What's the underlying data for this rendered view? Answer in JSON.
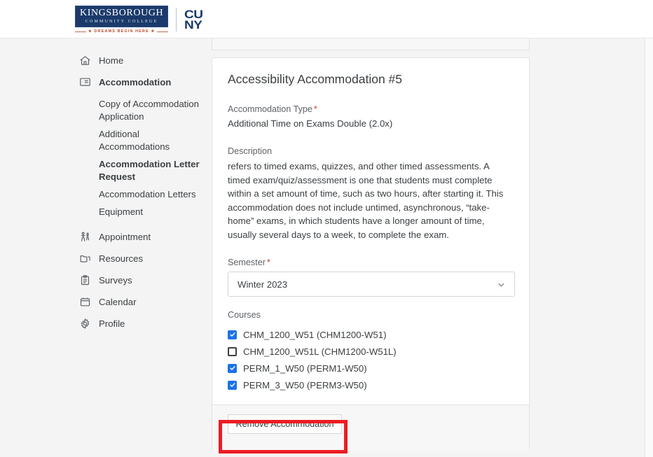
{
  "header": {
    "kbcc_name": "KINGSBOROUGH",
    "kbcc_sub": "COMMUNITY COLLEGE",
    "kbcc_tagline": "★ DREAMS BEGIN HERE ★",
    "cuny_line1": "CU",
    "cuny_line2": "NY"
  },
  "sidebar": {
    "items": [
      {
        "label": "Home",
        "icon": "home-icon"
      },
      {
        "label": "Accommodation",
        "icon": "accommodation-icon"
      },
      {
        "label": "Appointment",
        "icon": "appointment-icon"
      },
      {
        "label": "Resources",
        "icon": "folder-icon"
      },
      {
        "label": "Surveys",
        "icon": "clipboard-icon"
      },
      {
        "label": "Calendar",
        "icon": "calendar-icon"
      },
      {
        "label": "Profile",
        "icon": "gear-icon"
      }
    ],
    "sub_items": [
      {
        "label": "Copy of Accommodation Application",
        "active": false
      },
      {
        "label": "Additional Accommodations",
        "active": false
      },
      {
        "label": "Accommodation Letter Request",
        "active": true
      },
      {
        "label": "Accommodation Letters",
        "active": false
      },
      {
        "label": "Equipment",
        "active": false
      }
    ]
  },
  "card": {
    "title": "Accessibility Accommodation #5",
    "type_label": "Accommodation Type",
    "type_required": "*",
    "type_value": "Additional Time on Exams Double (2.0x)",
    "description_label": "Description",
    "description_text": "refers to timed exams, quizzes, and other timed assessments. A timed exam/quiz/assessment is one that students must complete within a set amount of time, such as two hours, after starting it. This accommodation does not include untimed, asynchronous, “take-home” exams, in which students have a longer amount of time, usually several days to a week, to complete the exam.",
    "semester_label": "Semester",
    "semester_required": "*",
    "semester_value": "Winter 2023",
    "courses_label": "Courses",
    "courses": [
      {
        "label": "CHM_1200_W51 (CHM1200-W51)",
        "checked": true
      },
      {
        "label": "CHM_1200_W51L (CHM1200-W51L)",
        "checked": false
      },
      {
        "label": "PERM_1_W50 (PERM1-W50)",
        "checked": true
      },
      {
        "label": "PERM_3_W50 (PERM3-W50)",
        "checked": true
      }
    ],
    "remove_button": "Remove Accommodation"
  },
  "colors": {
    "brand_navy": "#1b3a6b",
    "tagline_red": "#c0492b",
    "checkbox_blue": "#1a73e8",
    "required_red": "#d93025",
    "annotation_red": "#ed1c24"
  }
}
